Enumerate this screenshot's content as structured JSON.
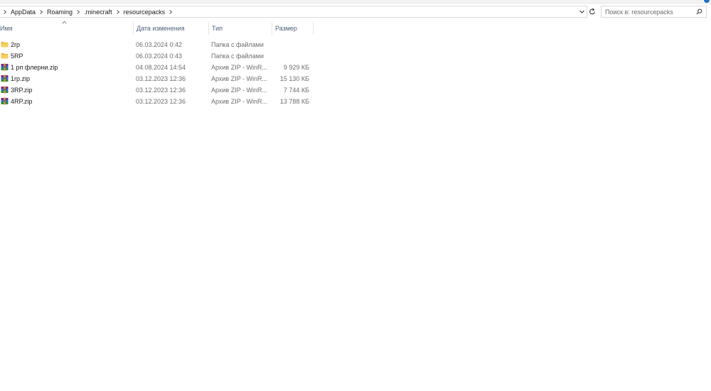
{
  "colors": {
    "accent": "#1e70c1",
    "header_text": "#4c607a",
    "folder": "#f4c542"
  },
  "address_bar": {
    "breadcrumbs": [
      "AppData",
      "Roaming",
      ".minecraft",
      "resourcepacks"
    ],
    "separator_icon": "chevron-right-icon",
    "dropdown_icon": "chevron-down-icon",
    "refresh_icon": "refresh-icon"
  },
  "search": {
    "placeholder": "Поиск в: resourcepacks",
    "value": "",
    "icon": "search-icon"
  },
  "columns": {
    "name": "Имя",
    "date": "Дата изменения",
    "type": "Тип",
    "size": "Размер",
    "sort_indicator": "caret-up-icon"
  },
  "files": [
    {
      "name": "2rp",
      "date": "06.03.2024 0:42",
      "type": "Папка с файлами",
      "size": "",
      "icon": "folder-icon"
    },
    {
      "name": "5RP",
      "date": "06.03.2024 0:43",
      "type": "Папка с файлами",
      "size": "",
      "icon": "folder-icon"
    },
    {
      "name": "1 рп флерни.zip",
      "date": "04.08.2024 14:54",
      "type": "Архив ZIP - WinR...",
      "size": "9 929 КБ",
      "icon": "winrar-archive-icon"
    },
    {
      "name": "1rp.zip",
      "date": "03.12.2023 12:36",
      "type": "Архив ZIP - WinR...",
      "size": "15 130 КБ",
      "icon": "winrar-archive-icon"
    },
    {
      "name": "3RP.zip",
      "date": "03.12.2023 12:36",
      "type": "Архив ZIP - WinR...",
      "size": "7 744 КБ",
      "icon": "winrar-archive-icon"
    },
    {
      "name": "4RP.zip",
      "date": "03.12.2023 12:36",
      "type": "Архив ZIP - WinR...",
      "size": "13 788 КБ",
      "icon": "winrar-archive-icon"
    }
  ]
}
